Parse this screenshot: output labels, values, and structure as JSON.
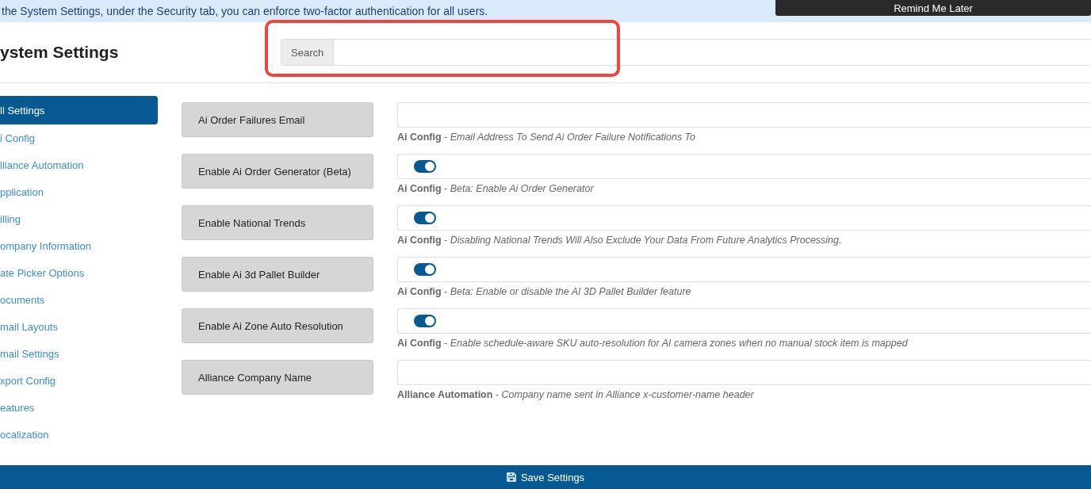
{
  "banner": {
    "text": "the System Settings, under the Security tab, you can enforce two-factor authentication for all users.",
    "button": "Remind Me Later"
  },
  "page_title": "ystem Settings",
  "search": {
    "addon": "Search",
    "highlighted": true
  },
  "sidebar": {
    "items": [
      {
        "label": "ll Settings",
        "selected": true
      },
      {
        "label": "i Config",
        "selected": false
      },
      {
        "label": "lliance Automation",
        "selected": false
      },
      {
        "label": "pplication",
        "selected": false
      },
      {
        "label": "illing",
        "selected": false
      },
      {
        "label": "ompany Information",
        "selected": false
      },
      {
        "label": "ate Picker Options",
        "selected": false
      },
      {
        "label": "ocuments",
        "selected": false
      },
      {
        "label": "mail Layouts",
        "selected": false
      },
      {
        "label": "mail Settings",
        "selected": false
      },
      {
        "label": "xport Config",
        "selected": false
      },
      {
        "label": "eatures",
        "selected": false
      },
      {
        "label": "ocalization",
        "selected": false
      }
    ]
  },
  "settings": [
    {
      "kind": "text",
      "label": "Ai Order Failures Email",
      "description": "**Ai Config** - *Email Address To Send Ai Order Failure Notifications To*"
    },
    {
      "kind": "toggle",
      "label": "Enable Ai Order Generator (Beta)",
      "on": true,
      "description": "**Ai Config** - *Beta: Enable Ai Order Generator*"
    },
    {
      "kind": "toggle",
      "label": "Enable National Trends",
      "on": true,
      "description": "**Ai Config** - *Disabling National Trends Will Also Exclude Your Data From Future Analytics Processing.*"
    },
    {
      "kind": "toggle",
      "label": "Enable Ai 3d Pallet Builder",
      "on": true,
      "description": "**Ai Config** - *Beta: Enable or disable the AI 3D Pallet Builder feature*"
    },
    {
      "kind": "toggle",
      "label": "Enable Ai Zone Auto Resolution",
      "on": true,
      "description": "**Ai Config** - *Enable schedule-aware SKU auto-resolution for AI camera zones when no manual stock item is mapped*"
    },
    {
      "kind": "text",
      "label": "Alliance Company Name",
      "description": "**Alliance Automation** - *Company name sent in Alliance x-customer-name header*"
    }
  ],
  "save_button": "Save Settings"
}
